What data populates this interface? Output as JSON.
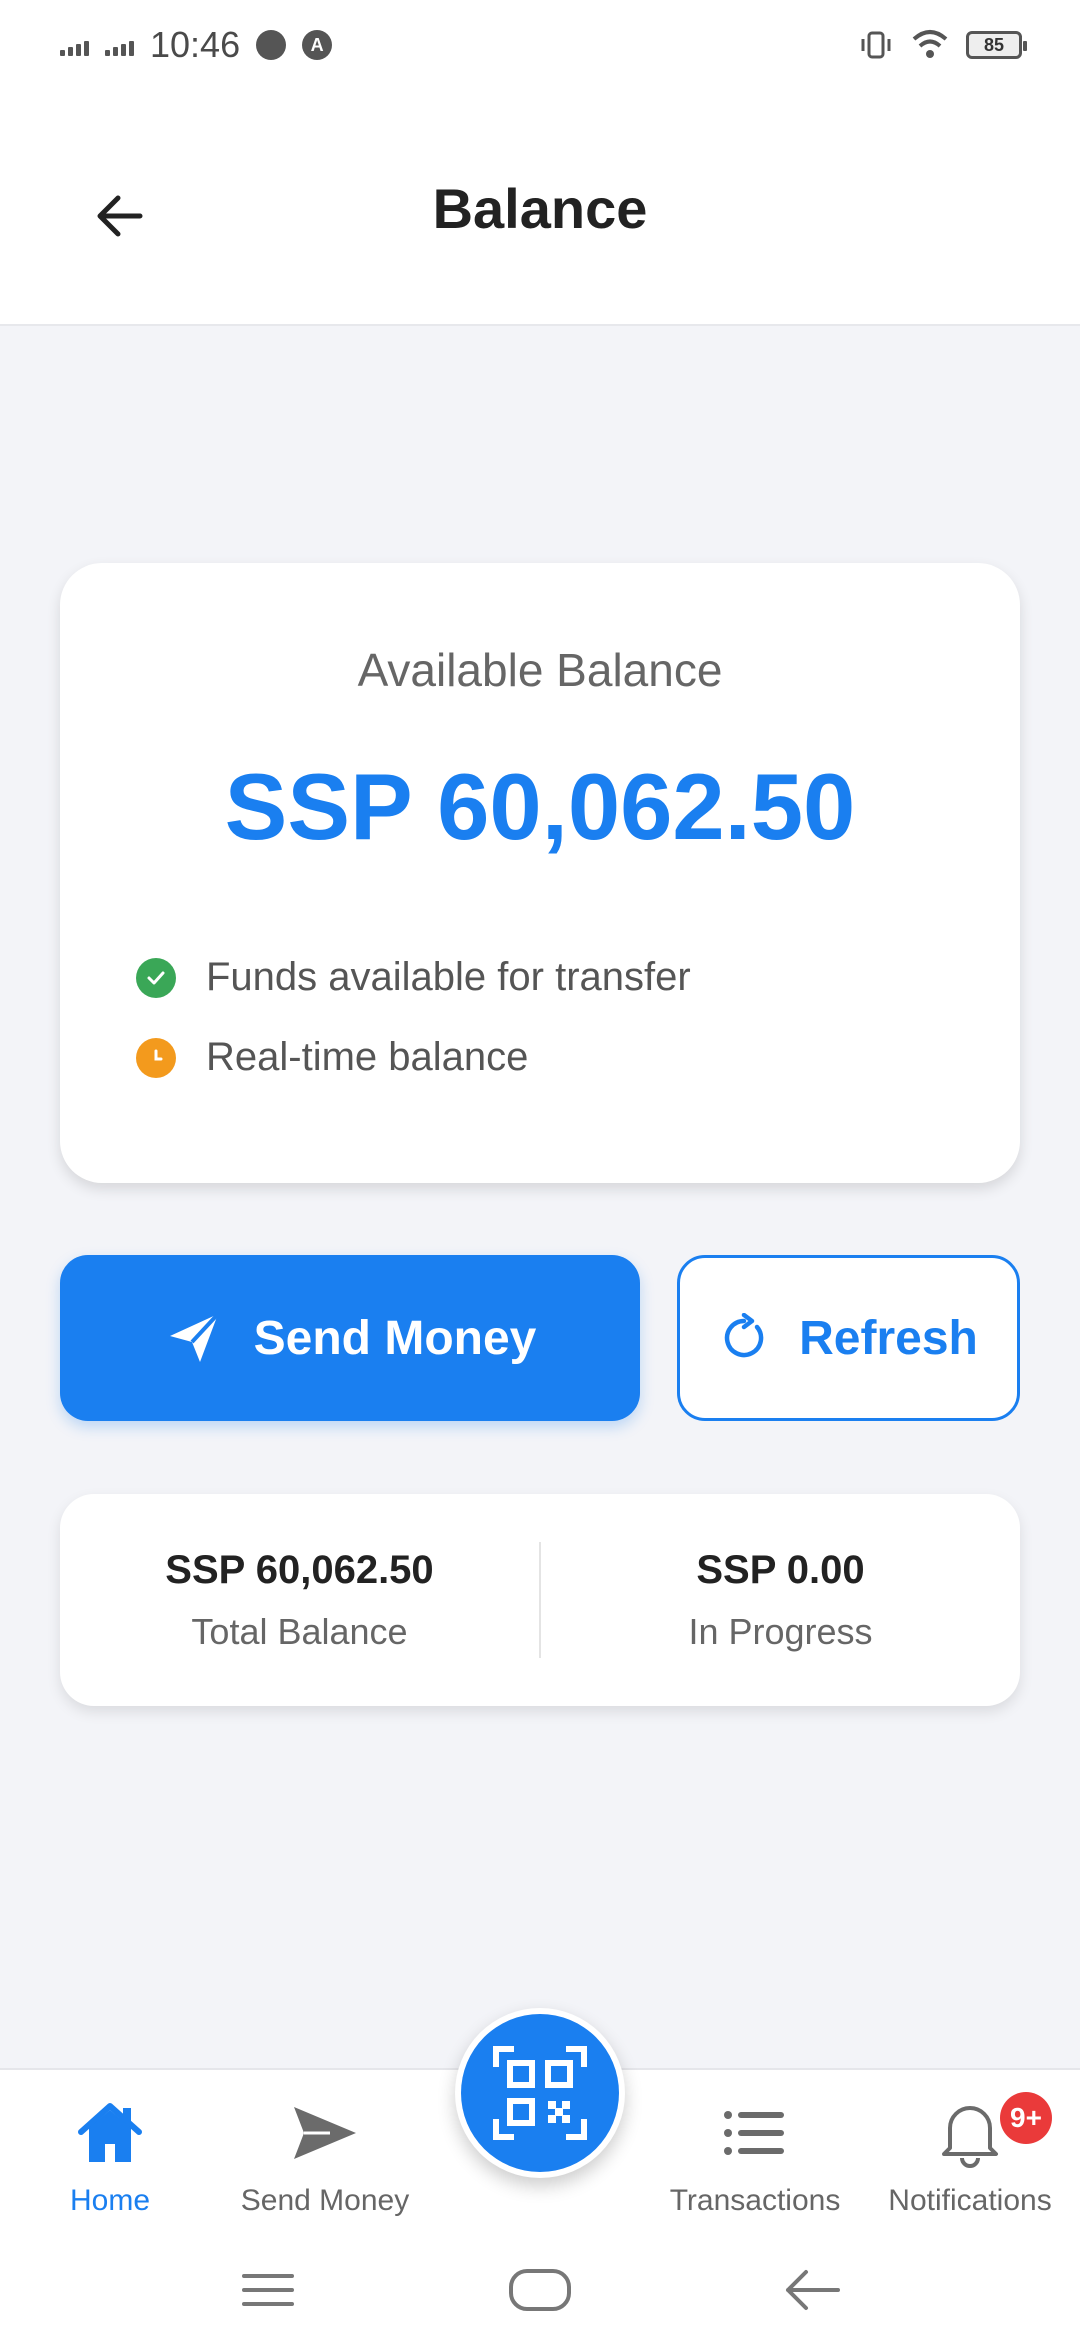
{
  "status_bar": {
    "time": "10:46",
    "battery": "85",
    "icons": [
      "signal-icon",
      "signal-icon",
      "chat-icon",
      "app-icon",
      "vibrate-icon",
      "wifi-icon",
      "battery-icon"
    ]
  },
  "header": {
    "title": "Balance",
    "back_icon": "arrow-left-icon"
  },
  "balance_card": {
    "label": "Available Balance",
    "amount": "SSP 60,062.50",
    "features": [
      {
        "icon": "check-circle-icon",
        "text": "Funds available for transfer",
        "color": "#3aa757"
      },
      {
        "icon": "clock-icon",
        "text": "Real-time balance",
        "color": "#f39a1d"
      }
    ]
  },
  "actions": {
    "send_label": "Send Money",
    "refresh_label": "Refresh"
  },
  "summary": {
    "total_amount": "SSP 60,062.50",
    "total_label": "Total Balance",
    "progress_amount": "SSP 0.00",
    "progress_label": "In Progress"
  },
  "bottom_nav": {
    "items": [
      {
        "label": "Home",
        "icon": "home-icon",
        "active": true
      },
      {
        "label": "Send Money",
        "icon": "send-icon",
        "active": false
      },
      {
        "label": "Transactions",
        "icon": "list-icon",
        "active": false
      },
      {
        "label": "Notifications",
        "icon": "bell-icon",
        "active": false
      }
    ],
    "badge": "9+",
    "fab_icon": "qr-code-icon"
  },
  "colors": {
    "accent": "#1a7ff0",
    "success": "#3aa757",
    "warning": "#f39a1d",
    "badge": "#ea3a3a"
  }
}
